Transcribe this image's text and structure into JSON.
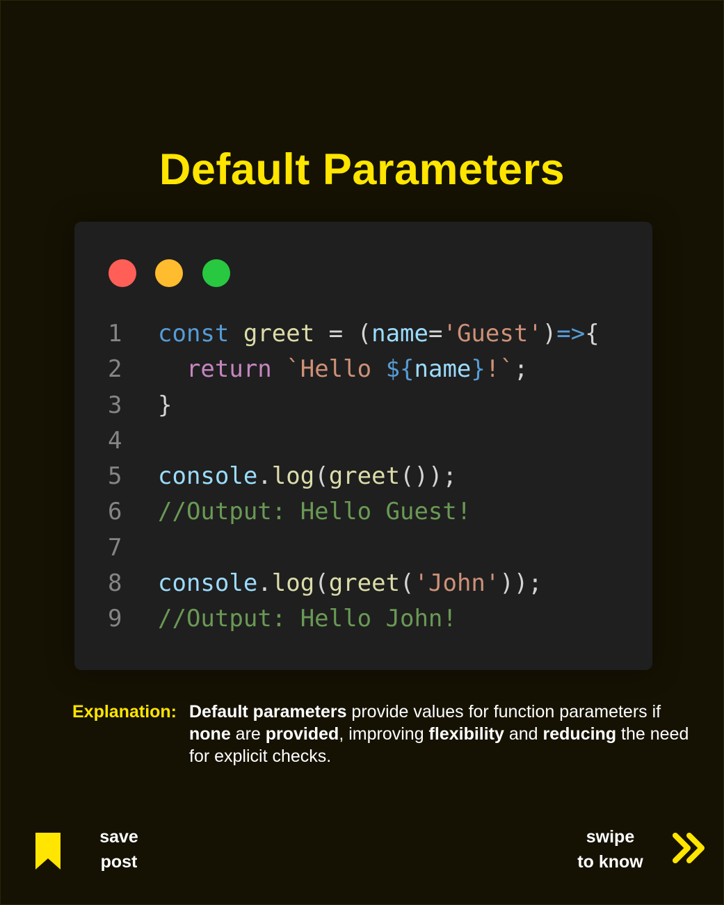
{
  "title": "Default Parameters",
  "window_controls": [
    "close",
    "minimize",
    "maximize"
  ],
  "code": {
    "lines": [
      {
        "num": "1",
        "tokens": [
          {
            "t": "const",
            "c": "kw"
          },
          {
            "t": " ",
            "c": "pun"
          },
          {
            "t": "greet",
            "c": "fn"
          },
          {
            "t": " = (",
            "c": "pun"
          },
          {
            "t": "name",
            "c": "var"
          },
          {
            "t": "=",
            "c": "pun"
          },
          {
            "t": "'Guest'",
            "c": "str"
          },
          {
            "t": ")",
            "c": "pun"
          },
          {
            "t": "=>",
            "c": "kw"
          },
          {
            "t": "{",
            "c": "pun"
          }
        ]
      },
      {
        "num": "2",
        "tokens": [
          {
            "t": "  ",
            "c": "pun"
          },
          {
            "t": "return",
            "c": "ret"
          },
          {
            "t": " ",
            "c": "pun"
          },
          {
            "t": "`Hello ",
            "c": "str"
          },
          {
            "t": "${",
            "c": "kw"
          },
          {
            "t": "name",
            "c": "var"
          },
          {
            "t": "}",
            "c": "kw"
          },
          {
            "t": "!`",
            "c": "str"
          },
          {
            "t": ";",
            "c": "pun"
          }
        ]
      },
      {
        "num": "3",
        "tokens": [
          {
            "t": "}",
            "c": "pun"
          }
        ]
      },
      {
        "num": "4",
        "tokens": []
      },
      {
        "num": "5",
        "tokens": [
          {
            "t": "console",
            "c": "var"
          },
          {
            "t": ".",
            "c": "pun"
          },
          {
            "t": "log",
            "c": "fn"
          },
          {
            "t": "(",
            "c": "pun"
          },
          {
            "t": "greet",
            "c": "fn"
          },
          {
            "t": "());",
            "c": "pun"
          }
        ]
      },
      {
        "num": "6",
        "tokens": [
          {
            "t": "//Output: Hello Guest!",
            "c": "cm"
          }
        ]
      },
      {
        "num": "7",
        "tokens": []
      },
      {
        "num": "8",
        "tokens": [
          {
            "t": "console",
            "c": "var"
          },
          {
            "t": ".",
            "c": "pun"
          },
          {
            "t": "log",
            "c": "fn"
          },
          {
            "t": "(",
            "c": "pun"
          },
          {
            "t": "greet",
            "c": "fn"
          },
          {
            "t": "(",
            "c": "pun"
          },
          {
            "t": "'John'",
            "c": "str"
          },
          {
            "t": "));",
            "c": "pun"
          }
        ]
      },
      {
        "num": "9",
        "tokens": [
          {
            "t": "//Output: Hello John!",
            "c": "cm"
          }
        ]
      }
    ]
  },
  "explanation": {
    "label": "Explanation:",
    "parts": [
      {
        "t": "Default parameters",
        "b": true
      },
      {
        "t": " provide values for function parameters if ",
        "b": false
      },
      {
        "t": "none",
        "b": true
      },
      {
        "t": " are ",
        "b": false
      },
      {
        "t": "provided",
        "b": true
      },
      {
        "t": ", improving ",
        "b": false
      },
      {
        "t": "flexibility",
        "b": true
      },
      {
        "t": " and ",
        "b": false
      },
      {
        "t": "reducing",
        "b": true
      },
      {
        "t": " the need for explicit checks.",
        "b": false
      }
    ]
  },
  "footer": {
    "save_line1": "save",
    "save_line2": "post",
    "swipe_line1": "swipe",
    "swipe_line2": "to know",
    "save_icon": "bookmark-icon",
    "swipe_icon": "double-chevron-right-icon"
  },
  "colors": {
    "accent": "#ffe500",
    "background": "#151203",
    "code_bg": "#1f1f1f"
  }
}
